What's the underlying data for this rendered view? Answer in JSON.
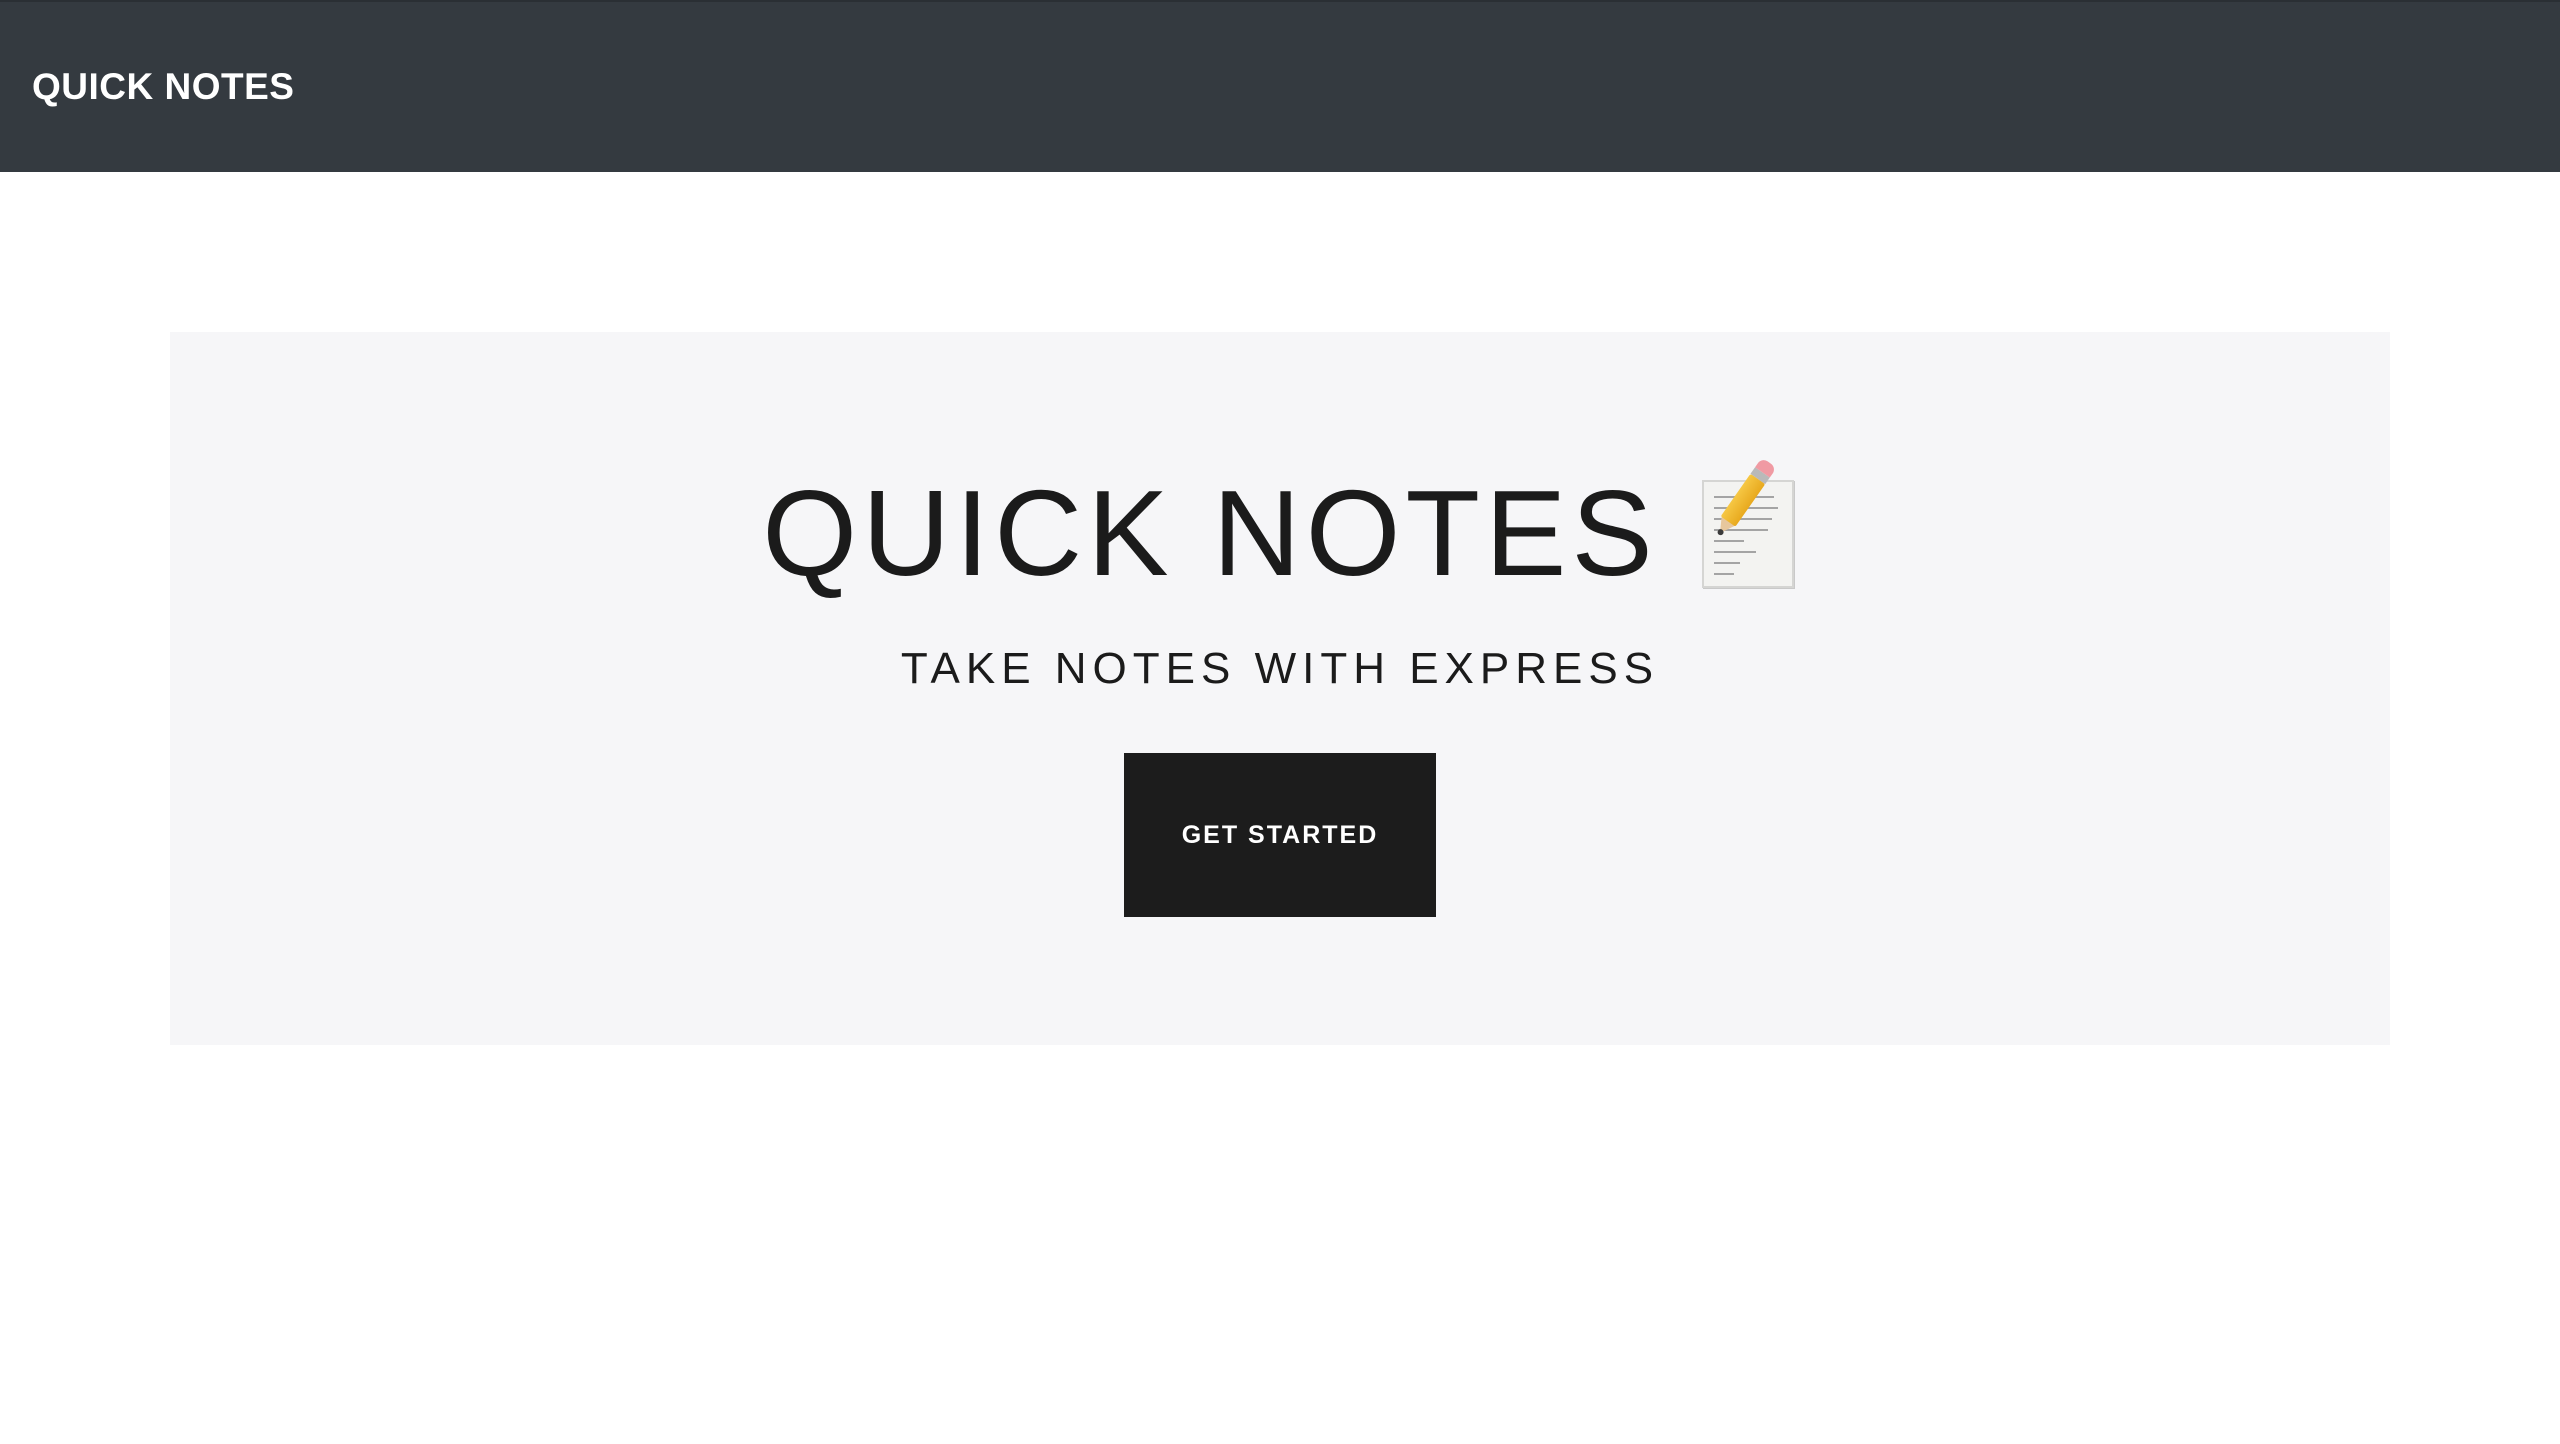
{
  "navbar": {
    "brand": "QUICK NOTES",
    "background_color": "#343a40",
    "text_color": "#ffffff"
  },
  "hero": {
    "title": "QUICK NOTES",
    "title_icon": "memo-pencil-icon",
    "subtitle": "TAKE NOTES WITH EXPRESS",
    "button_label": "GET STARTED",
    "panel_color": "#f6f6f8",
    "button_color": "#1c1c1c"
  }
}
